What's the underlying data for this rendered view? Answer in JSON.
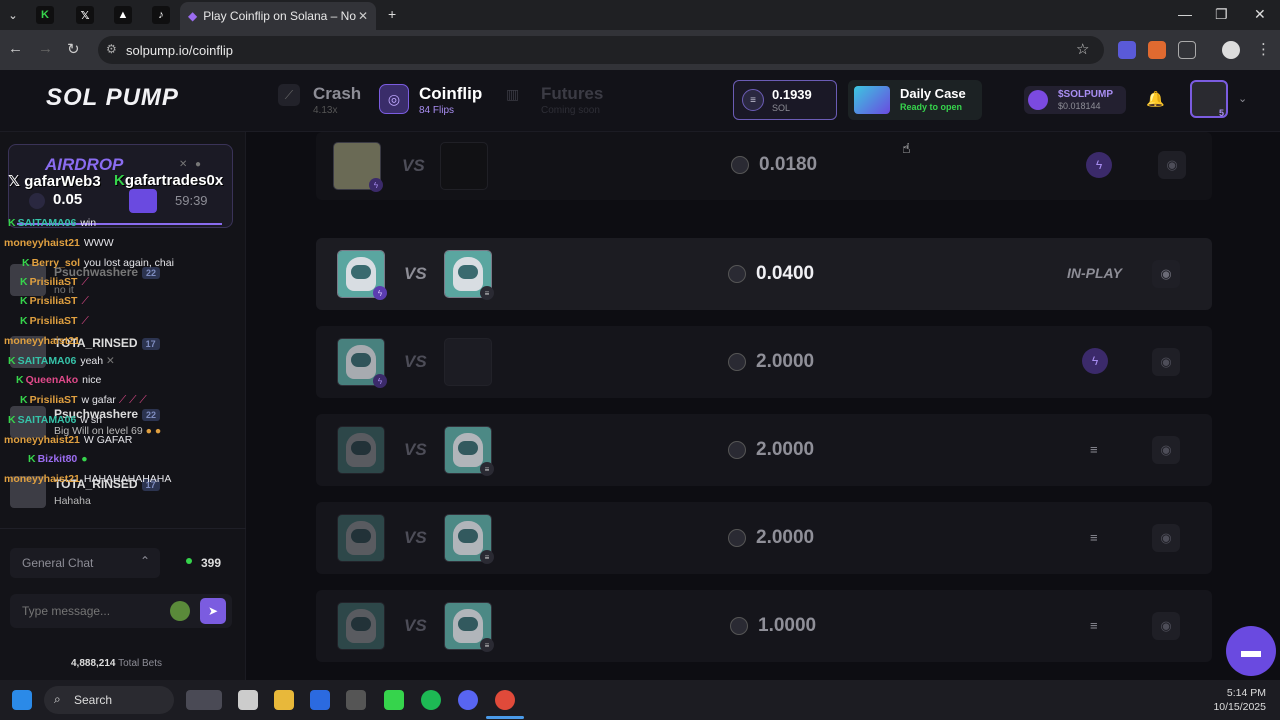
{
  "browser": {
    "active_tab_title": "Play Coinflip on Solana – No KY",
    "url": "solpump.io/coinflip"
  },
  "header": {
    "logo_text": "SOL PUMP",
    "nav": [
      {
        "name": "Crash",
        "sub": "4.13x"
      },
      {
        "name": "Coinflip",
        "sub": "84 Flips"
      },
      {
        "name": "Futures",
        "sub": "Coming soon"
      }
    ],
    "wallet": {
      "amount": "0.1939",
      "currency": "SOL"
    },
    "daily_case": {
      "title": "Daily Case",
      "status": "Ready to open"
    },
    "token": {
      "name": "$SOLPUMP",
      "price": "$0.018144"
    },
    "user_level": "5"
  },
  "sidebar": {
    "airdrop": {
      "title": "AIRDROP",
      "overlay_left": "gafarWeb3",
      "overlay_right": "gafartrades0x",
      "amount": "0.05",
      "timer": "59:39"
    },
    "chat": [
      {
        "user": "SAITAMA06",
        "msg": "win",
        "color": "#36c2a8"
      },
      {
        "user": "moneyyhaist21",
        "msg": "WWW",
        "color": "#e0a040"
      },
      {
        "user": "Berry_sol",
        "msg": "you lost again, chai",
        "color": "#e0a040"
      },
      {
        "user": "Psuchwashere",
        "msg": "no it",
        "color": "#cfcfd6"
      },
      {
        "user": "PrisiliaST",
        "msg": "",
        "color": "#e0a040"
      },
      {
        "user": "PrisiliaST",
        "msg": "",
        "color": "#e0a040"
      },
      {
        "user": "PrisiliaST",
        "msg": "",
        "color": "#e0a040"
      },
      {
        "user": "moneyyhaist21",
        "msg": "TOTA_RINSED",
        "color": "#e0a040"
      },
      {
        "user": "SAITAMA06",
        "msg": "yeah",
        "color": "#36c2a8"
      },
      {
        "user": "QueenAko",
        "msg": "nice",
        "color": "#e04a8a"
      },
      {
        "user": "PrisiliaST",
        "msg": "w gafar",
        "color": "#e0a040"
      },
      {
        "user": "SAITAMA06",
        "msg": "w sh",
        "color": "#36c2a8"
      },
      {
        "user": "Big Will on level 69",
        "msg": "",
        "color": "#cfcfd6"
      },
      {
        "user": "moneyyhaist21",
        "msg": "W GAFAR",
        "color": "#e0a040"
      },
      {
        "user": "Bizkit80",
        "msg": "",
        "color": "#9b6cf0"
      },
      {
        "user": "moneyyhaist21",
        "msg": "HAHAHAHAHAHA",
        "color": "#e0a040"
      },
      {
        "user": "TOTA_RINSED",
        "msg": "Hahaha",
        "color": "#cfcfd6"
      }
    ],
    "underlay_users": [
      {
        "name": "Psuchwashere",
        "level": "22"
      },
      {
        "name": "TOTA_RINSED",
        "level": "17"
      },
      {
        "name": "Psuchwashere",
        "level": "22"
      },
      {
        "name": "TOTA_RINSED",
        "level": "17"
      }
    ],
    "chat_room": "General Chat",
    "online": "399",
    "input_placeholder": "Type message...",
    "total_bets": "4,888,214",
    "total_bets_label": "Total Bets"
  },
  "games": [
    {
      "amount": "0.0180",
      "status": "",
      "highlight": false
    },
    {
      "amount": "0.0400",
      "status": "IN-PLAY",
      "highlight": true
    },
    {
      "amount": "2.0000",
      "status": "",
      "highlight": false
    },
    {
      "amount": "2.0000",
      "status": "",
      "highlight": false
    },
    {
      "amount": "2.0000",
      "status": "",
      "highlight": false
    },
    {
      "amount": "1.0000",
      "status": "",
      "highlight": false
    }
  ],
  "vs_label": "VS",
  "taskbar": {
    "search": "Search",
    "time": "5:14 PM",
    "date": "10/15/2025"
  }
}
